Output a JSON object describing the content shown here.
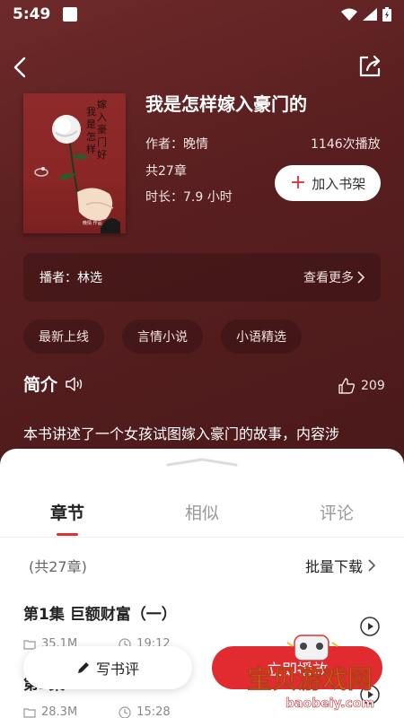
{
  "status_bar": {
    "time": "5:49"
  },
  "book": {
    "title": "我是怎样嫁入豪门的",
    "author": "作者：晚情",
    "plays": "1146次播放",
    "chapters": "共27章",
    "duration": "时长：7.9 小时",
    "add_label": "加入书架",
    "cover_title": "嫁入豪门好我是怎样"
  },
  "host": {
    "label": "播者：林选",
    "more_label": "查看更多"
  },
  "tags": [
    "最新上线",
    "言情小说",
    "小语精选"
  ],
  "intro": {
    "heading": "简介",
    "likes": "209",
    "text": "本书讲述了一个女孩试图嫁入豪门的故事，内容涉"
  },
  "tabs": [
    "章节",
    "相似",
    "评论"
  ],
  "chapter_list": {
    "count": "(共27章)",
    "batch_label": "批量下载",
    "episodes": [
      {
        "title": "第1集 巨额财富（一）",
        "size": "35.1M",
        "duration": "19:12"
      },
      {
        "title": "第2集",
        "size": "28.3M",
        "duration": "15:28"
      }
    ]
  },
  "actions": {
    "write_review": "写书评",
    "play": "立即播放"
  },
  "watermark": {
    "text": "宝贝游戏网",
    "url": "baobeiy.com"
  },
  "colors": {
    "accent": "#e22b30",
    "background": "#5a1f1f"
  }
}
